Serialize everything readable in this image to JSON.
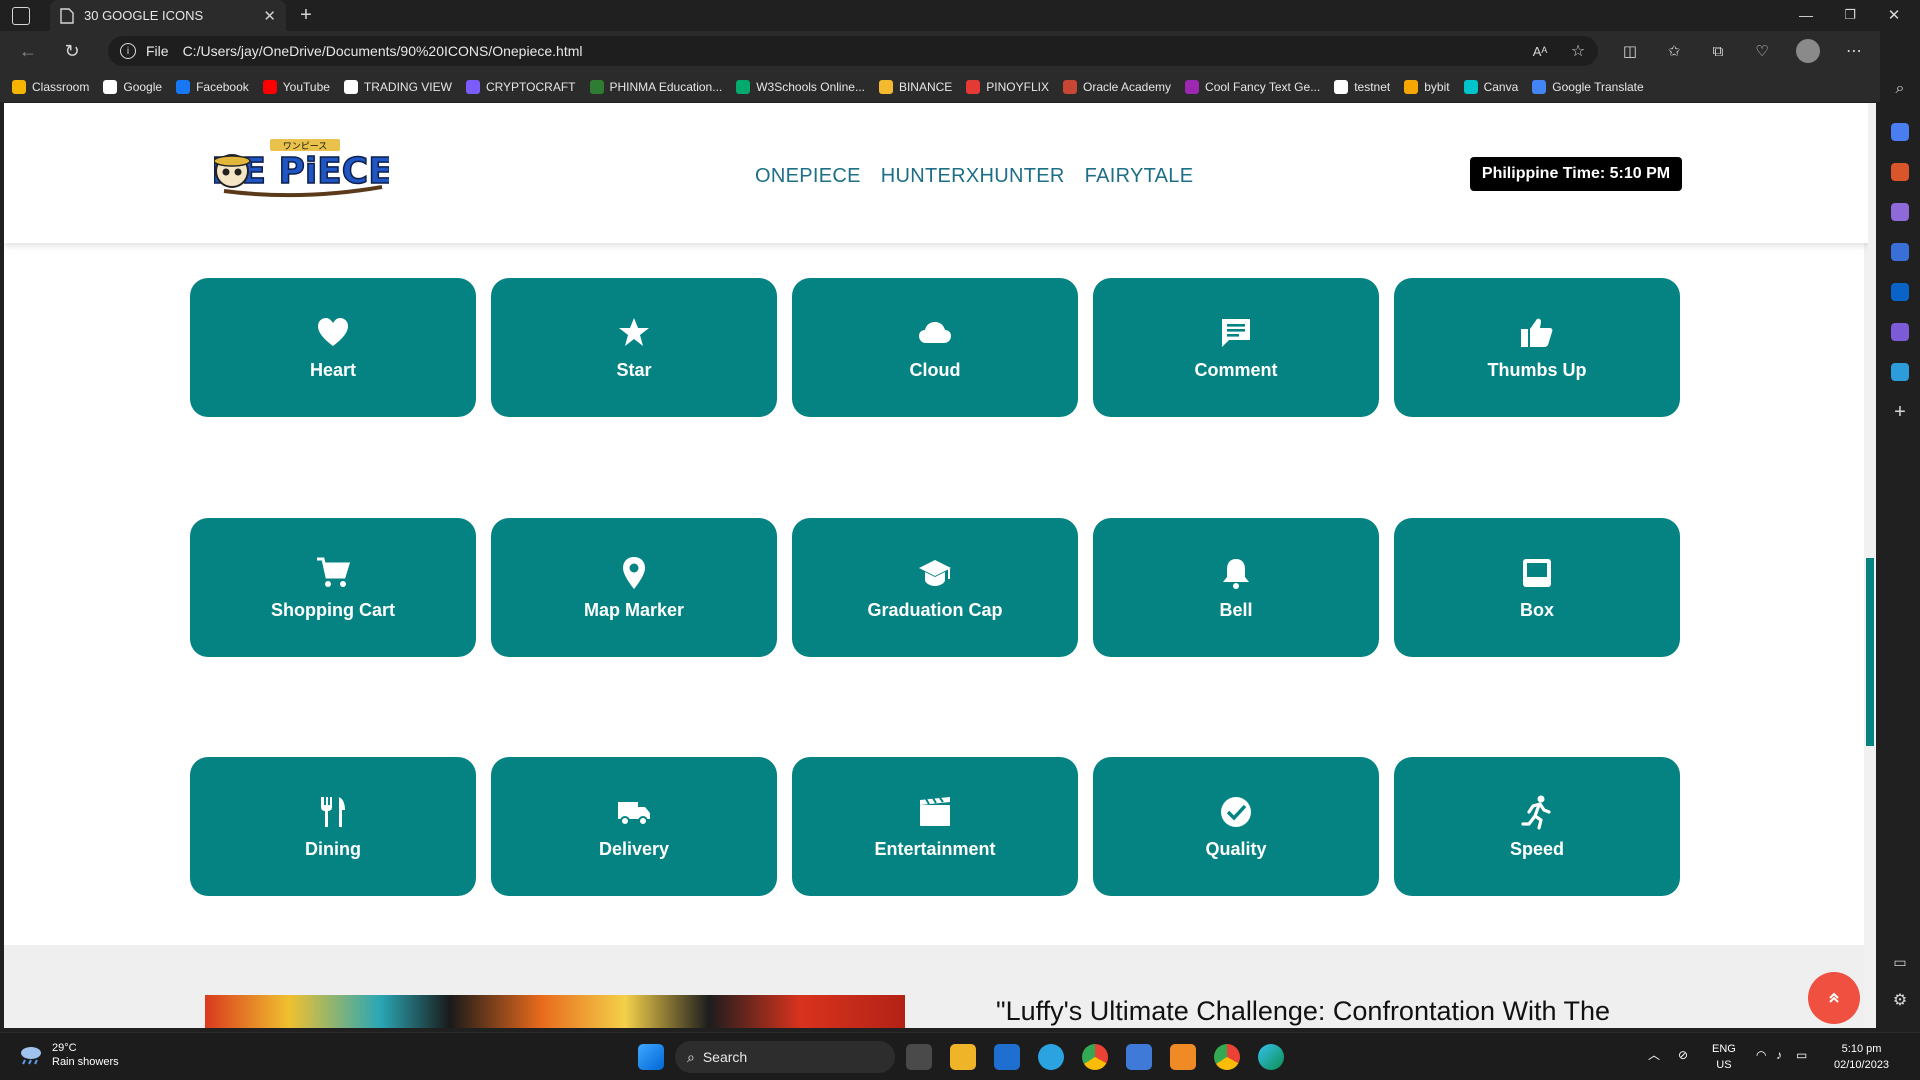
{
  "browser": {
    "tab_title": "30 GOOGLE ICONS",
    "url_scheme": "File",
    "url": "C:/Users/jay/OneDrive/Documents/90%20ICONS/Onepiece.html",
    "bookmarks": [
      "Classroom",
      "Google",
      "Facebook",
      "YouTube",
      "TRADING VIEW",
      "CRYPTOCRAFT",
      "PHINMA Education...",
      "W3Schools Online...",
      "BINANCE",
      "PINOYFLIX",
      "Oracle Academy",
      "Cool Fancy Text Ge...",
      "testnet",
      "bybit",
      "Canva",
      "Google Translate"
    ],
    "bookmark_colors": [
      "#f4b400",
      "#ffffff",
      "#1877f2",
      "#ff0000",
      "#ffffff",
      "#7a5cff",
      "#2e7d32",
      "#04aa6d",
      "#f3ba2f",
      "#e53935",
      "#c74634",
      "#9c27b0",
      "#ffffff",
      "#f7a600",
      "#00c4cc",
      "#4285f4"
    ]
  },
  "header": {
    "logo_text": "ONE PIECE",
    "logo_kana": "ワンピース",
    "nav": [
      "ONEPIECE",
      "HUNTERXHUNTER",
      "FAIRYTALE"
    ],
    "time_label": "Philippine Time: 5:10 PM"
  },
  "icons": [
    {
      "label": "Heart",
      "icon": "heart-icon"
    },
    {
      "label": "Star",
      "icon": "star-icon"
    },
    {
      "label": "Cloud",
      "icon": "cloud-icon"
    },
    {
      "label": "Comment",
      "icon": "comment-icon"
    },
    {
      "label": "Thumbs Up",
      "icon": "thumbs-up-icon"
    },
    {
      "label": "Shopping Cart",
      "icon": "shopping-cart-icon"
    },
    {
      "label": "Map Marker",
      "icon": "map-marker-icon"
    },
    {
      "label": "Graduation Cap",
      "icon": "graduation-cap-icon"
    },
    {
      "label": "Bell",
      "icon": "bell-icon"
    },
    {
      "label": "Box",
      "icon": "box-icon"
    },
    {
      "label": "Dining",
      "icon": "dining-icon"
    },
    {
      "label": "Delivery",
      "icon": "delivery-icon"
    },
    {
      "label": "Entertainment",
      "icon": "entertainment-icon"
    },
    {
      "label": "Quality",
      "icon": "quality-icon"
    },
    {
      "label": "Speed",
      "icon": "speed-icon"
    }
  ],
  "article": {
    "title": "\"Luffy's Ultimate Challenge: Confrontation With The"
  },
  "taskbar": {
    "temperature": "29°C",
    "weather": "Rain showers",
    "search_placeholder": "Search",
    "lang": "ENG",
    "region": "US",
    "time": "5:10 pm",
    "date": "02/10/2023"
  },
  "colors": {
    "card": "#058383",
    "nav": "#1d6e87",
    "back_to_top": "#ef5040"
  }
}
